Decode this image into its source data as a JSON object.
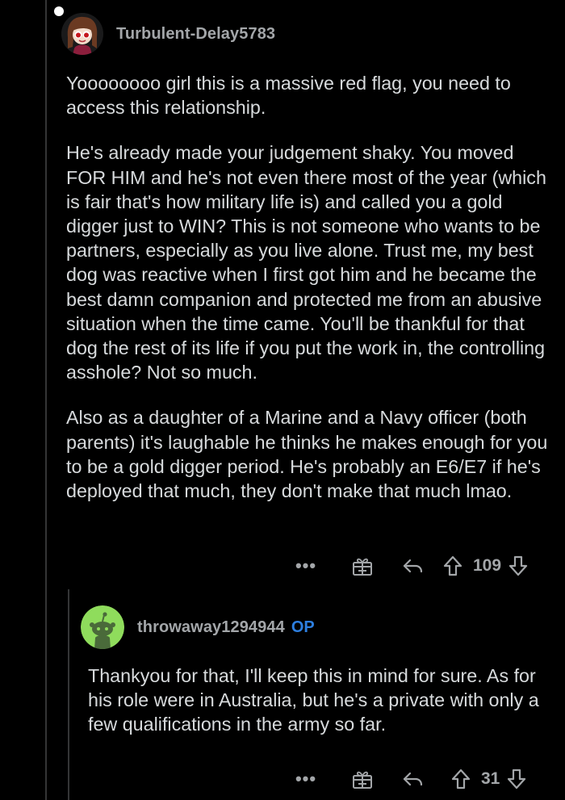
{
  "comments": [
    {
      "username": "Turbulent-Delay5783",
      "paragraphs": [
        "Yoooooooo girl this is a massive red flag, you need to access this relationship.",
        "He's already made your judgement shaky. You moved FOR HIM and he's not even there most of the year (which is fair that's how military life is) and called you a gold digger just to WIN? This is not someone who wants to be partners, especially as you live alone. Trust me, my best dog was reactive when I first got him and he became the best damn companion and protected me from an abusive situation when the time came. You'll be thankful for that dog the rest of its life if you put the work in, the controlling asshole? Not so much.",
        "Also as a daughter of a Marine and a Navy officer (both parents) it's laughable he thinks he makes enough for you to be a gold digger period. He's probably an E6/E7 if he's deployed that much, they don't make that much lmao."
      ],
      "more": "•••",
      "score": "109",
      "avatar_icon": "cartoon-girl-avatar"
    },
    {
      "username": "throwaway1294944",
      "op_badge": "OP",
      "paragraphs": [
        "Thankyou for that, I'll keep this in mind for sure. As for his role were in Australia, but he's a private with only a few qualifications in the army so far."
      ],
      "more": "•••",
      "score": "31",
      "avatar_icon": "snoo-avatar"
    }
  ],
  "colors": {
    "background": "#000000",
    "text": "#d7dadc",
    "muted": "#a3a6a9",
    "op": "#2d7fe0",
    "snoo_bg": "#8fdc5c"
  }
}
